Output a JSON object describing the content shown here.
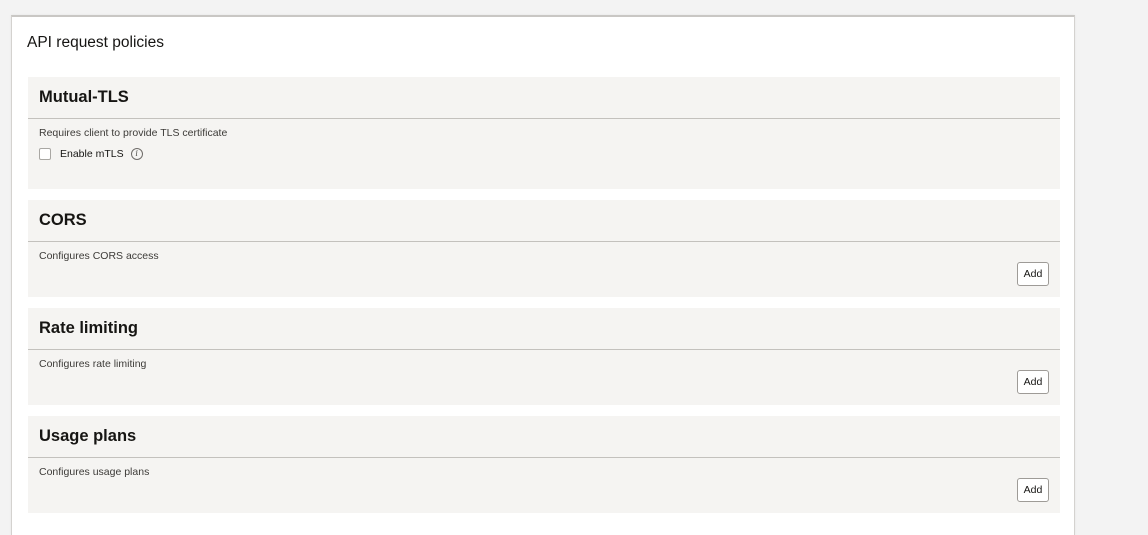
{
  "panel": {
    "title": "API request policies"
  },
  "mtls": {
    "title": "Mutual-TLS",
    "description": "Requires client to provide TLS certificate",
    "checkbox_label": "Enable mTLS",
    "checkbox_checked": false,
    "info_glyph": "i"
  },
  "cors": {
    "title": "CORS",
    "description": "Configures CORS access",
    "add_label": "Add"
  },
  "rate_limiting": {
    "title": "Rate limiting",
    "description": "Configures rate limiting",
    "add_label": "Add"
  },
  "usage_plans": {
    "title": "Usage plans",
    "description": "Configures usage plans",
    "add_label": "Add"
  }
}
